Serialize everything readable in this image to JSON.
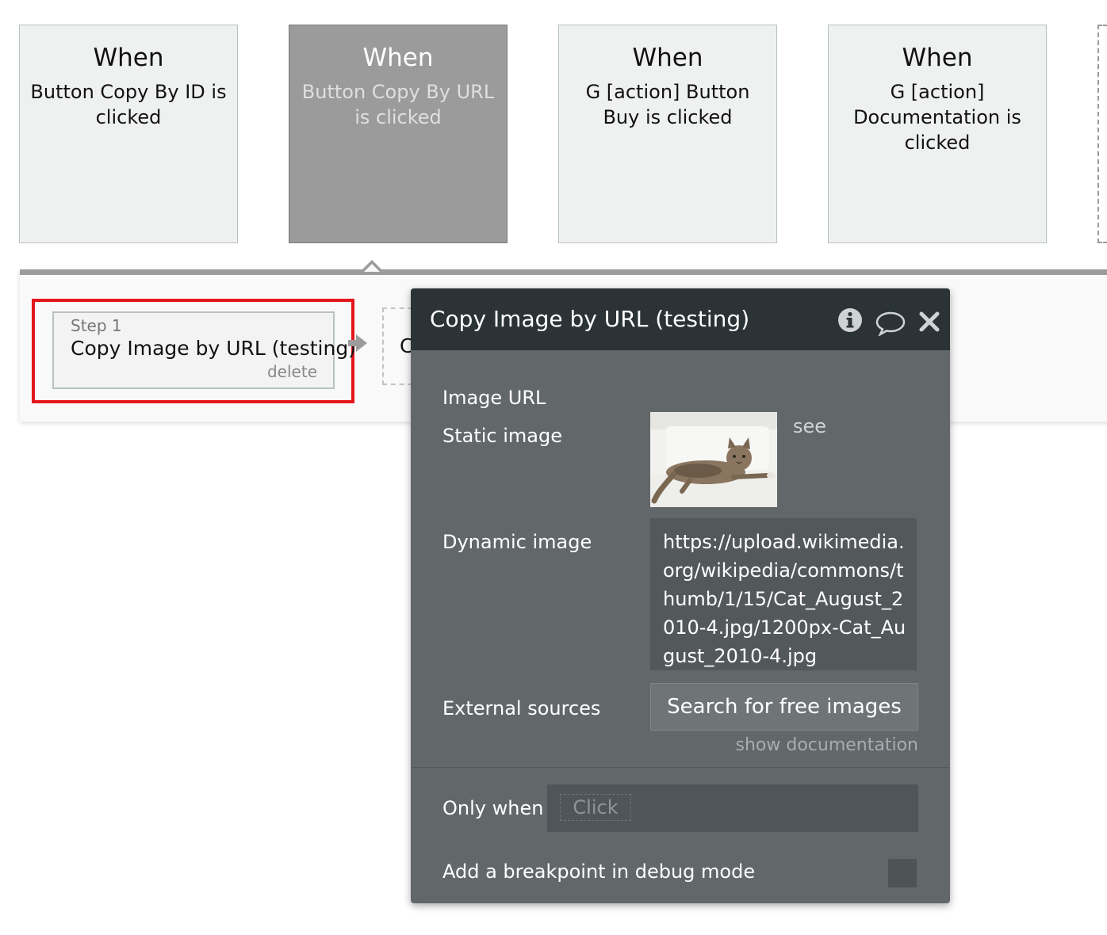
{
  "events": [
    {
      "when": "When",
      "description": "Button Copy By ID is clicked",
      "selected": false
    },
    {
      "when": "When",
      "description": "Button Copy By URL is clicked",
      "selected": true
    },
    {
      "when": "When",
      "description": "G [action] Button Buy is clicked",
      "selected": false
    },
    {
      "when": "When",
      "description": "G [action] Documentation is clicked",
      "selected": false
    }
  ],
  "workflow": {
    "step": {
      "label": "Step 1",
      "title": "Copy Image by URL (testing)",
      "delete_label": "delete"
    },
    "next_step_partial": "C"
  },
  "panel": {
    "title": "Copy Image by URL (testing)",
    "icons": [
      "info-icon",
      "comment-icon",
      "close-icon"
    ],
    "image_url_label": "Image URL",
    "static_image_label": "Static image",
    "see_label": "see",
    "dynamic_image_label": "Dynamic image",
    "dynamic_image_value": "https://upload.wikimedia.org/wikipedia/commons/thumb/1/15/Cat_August_2010-4.jpg/1200px-Cat_August_2010-4.jpg",
    "external_sources_label": "External sources",
    "search_button_label": "Search for free images",
    "show_documentation_label": "show documentation",
    "only_when_label": "Only when",
    "only_when_placeholder": "Click",
    "breakpoint_label": "Add a breakpoint in debug mode",
    "breakpoint_checked": false
  },
  "colors": {
    "highlight": "#e5161b",
    "panel_bg": "#62676a",
    "panel_header": "#2b3336",
    "selected_card": "#9b9b9b"
  }
}
